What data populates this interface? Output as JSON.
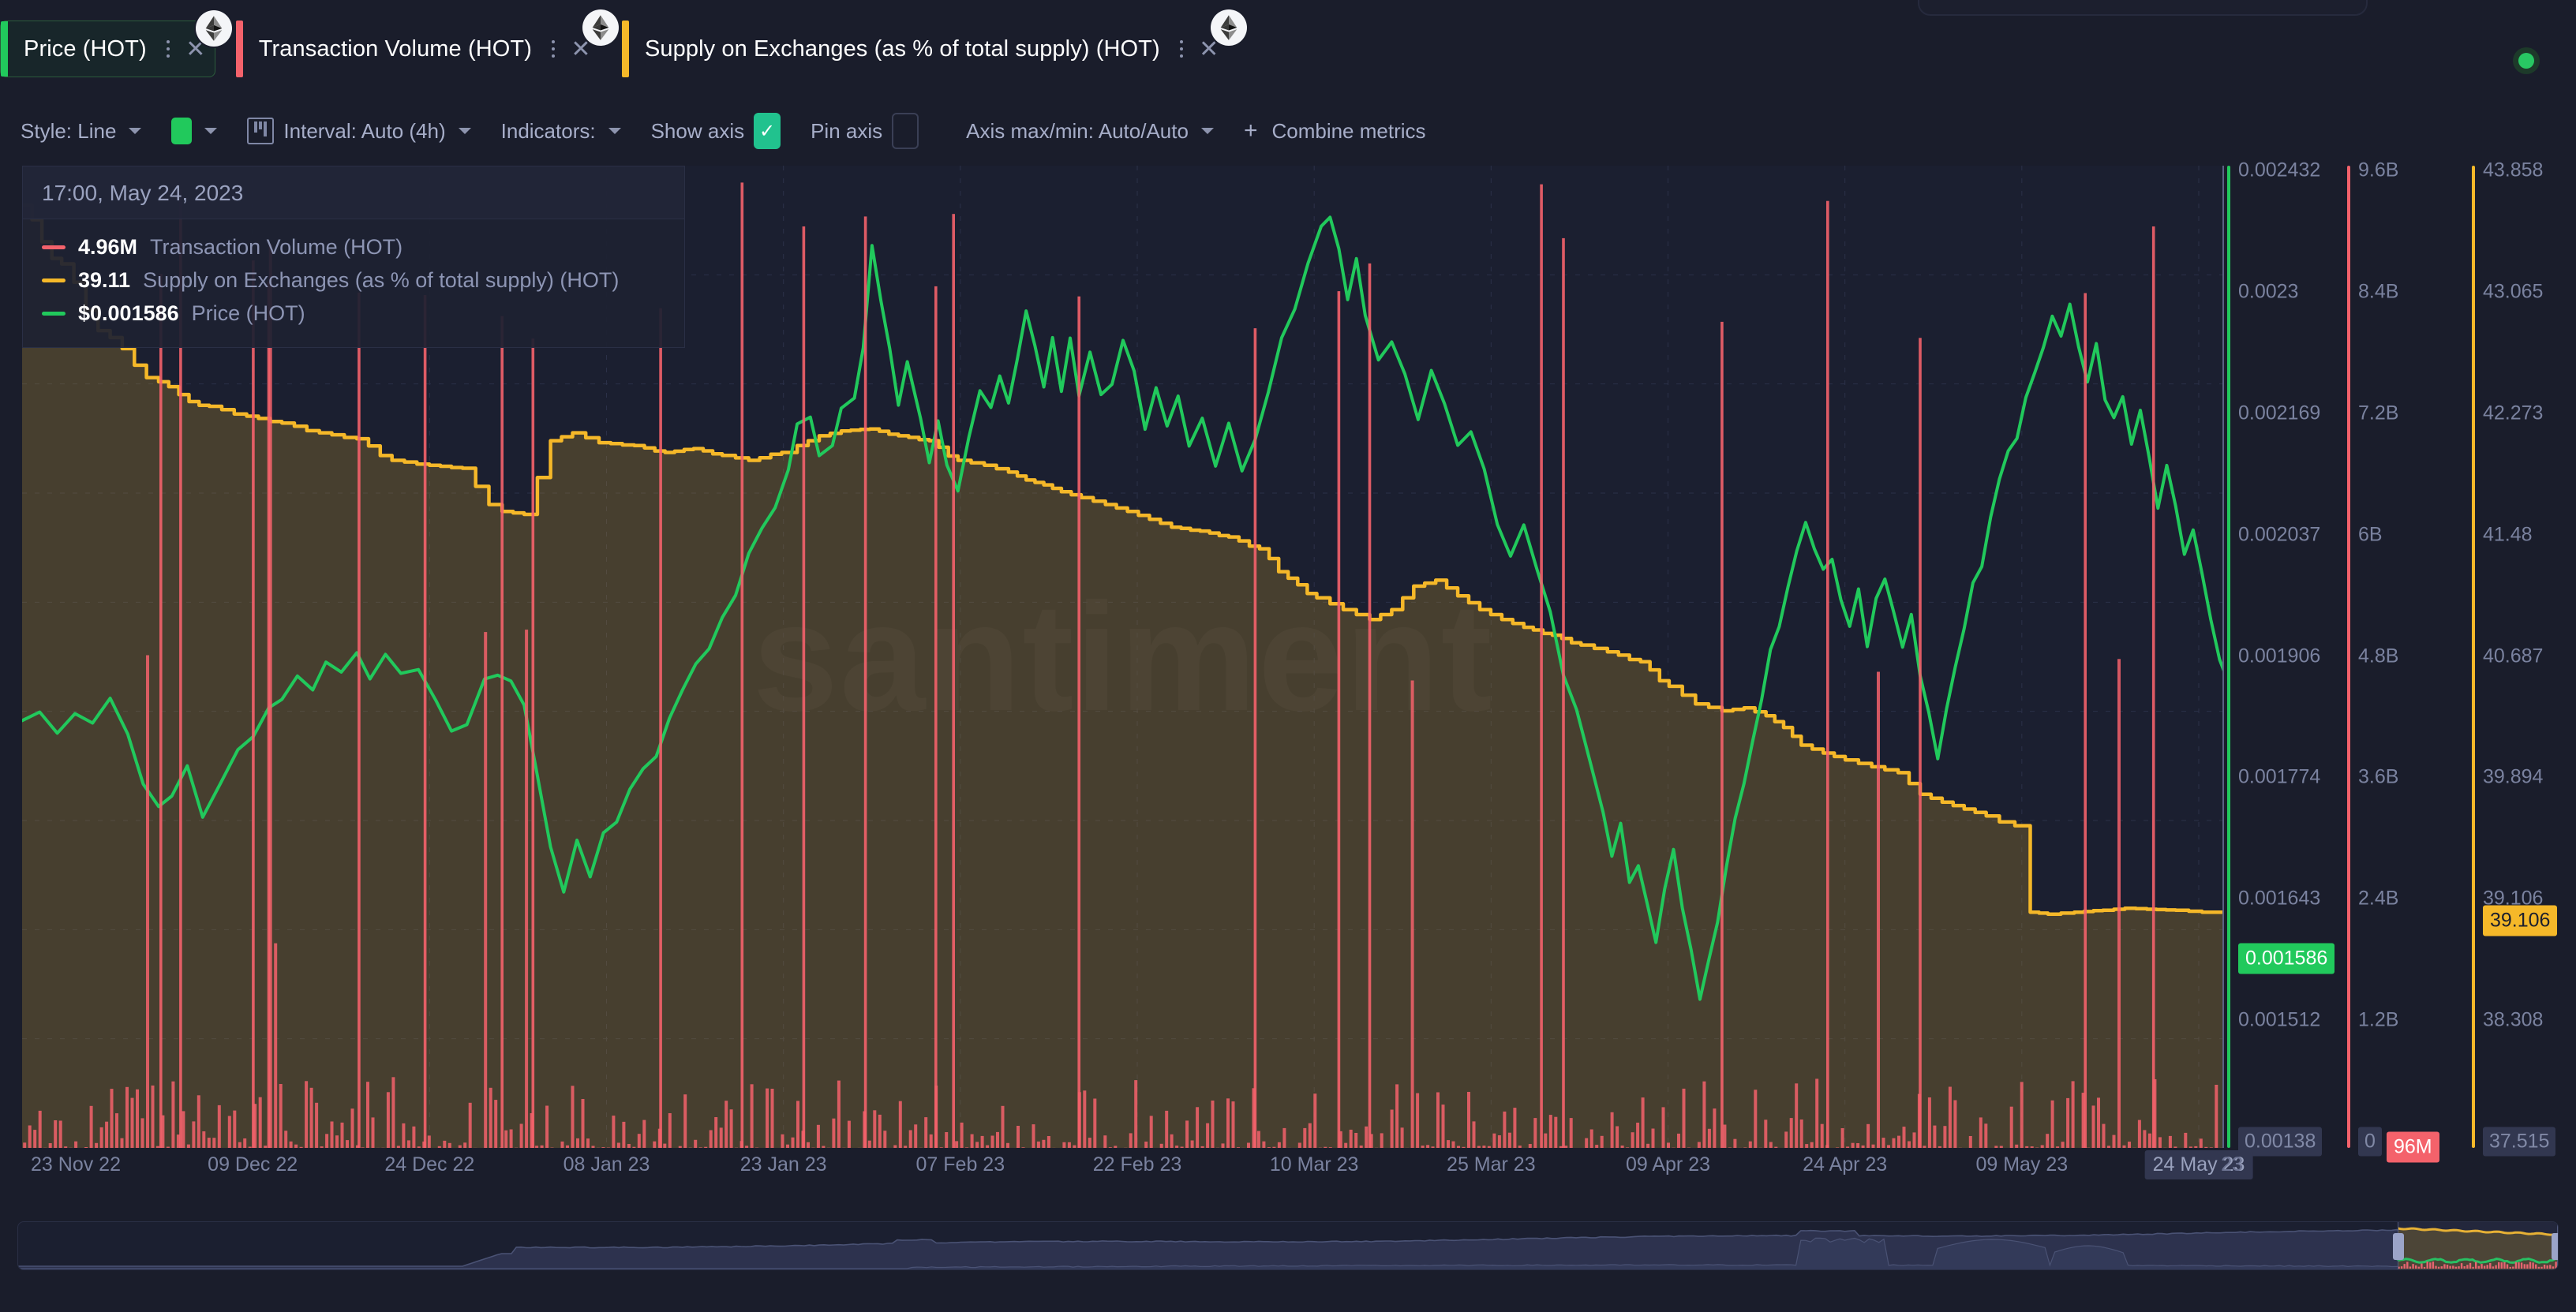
{
  "header": {
    "status_indicator": "online",
    "tabs": [
      {
        "label": "Price (HOT)",
        "accent_color": "#21c95c",
        "active": true,
        "asset_icon": "ethereum-icon",
        "menu_icon": "kebab-menu-icon",
        "close_icon": "close-icon"
      },
      {
        "label": "Transaction Volume (HOT)",
        "accent_color": "#f4626b",
        "active": false,
        "asset_icon": "ethereum-icon",
        "menu_icon": "kebab-menu-icon",
        "close_icon": "close-icon"
      },
      {
        "label": "Supply on Exchanges (as % of total supply) (HOT)",
        "accent_color": "#f5b829",
        "active": false,
        "asset_icon": "ethereum-icon",
        "menu_icon": "kebab-menu-icon",
        "close_icon": "close-icon"
      }
    ]
  },
  "toolbar": {
    "style_label": "Style: Line",
    "color_swatch": "#21c95c",
    "interval_label": "Interval: Auto (4h)",
    "indicators_label": "Indicators:",
    "show_axis_label": "Show axis",
    "show_axis_checked": true,
    "pin_axis_label": "Pin axis",
    "pin_axis_checked": false,
    "axis_minmax_label": "Axis max/min: Auto/Auto",
    "combine_metrics_label": "Combine metrics"
  },
  "tooltip": {
    "timestamp": "17:00, May 24, 2023",
    "rows": [
      {
        "value": "4.96M",
        "name": "Transaction Volume (HOT)",
        "color": "#f4626b"
      },
      {
        "value": "39.11",
        "name": "Supply on Exchanges (as % of total supply) (HOT)",
        "color": "#f5b829"
      },
      {
        "value": "$0.001586",
        "name": "Price (HOT)",
        "color": "#21c95c"
      }
    ]
  },
  "watermark": "santiment",
  "chart_data": {
    "type": "line",
    "title": "",
    "xlabel": "",
    "ylabel": "",
    "grid": true,
    "legend_position": "top-left-tooltip",
    "x_ticks": [
      "23 Nov 22",
      "09 Dec 22",
      "24 Dec 22",
      "08 Jan 23",
      "23 Jan 23",
      "07 Feb 23",
      "22 Feb 23",
      "10 Mar 23",
      "25 Mar 23",
      "09 Apr 23",
      "24 Apr 23",
      "09 May 23",
      "24 May 23",
      "23"
    ],
    "x_tick_highlighted": "24 May 23",
    "x_tick_trailing": "23",
    "axes": [
      {
        "name": "Price (HOT)",
        "color": "#21c95c",
        "ticks": [
          "0.002432",
          "0.0023",
          "0.002169",
          "0.002037",
          "0.001906",
          "0.001774",
          "0.001643",
          "0.001512",
          "0.00138"
        ],
        "range": [
          0.00138,
          0.002432
        ],
        "current_value": "0.001586",
        "current_badge_color": "#21c95c",
        "last_tick_boxed": "0.00138"
      },
      {
        "name": "Transaction Volume (HOT)",
        "color": "#f4626b",
        "ticks": [
          "9.6B",
          "8.4B",
          "7.2B",
          "6B",
          "4.8B",
          "3.6B",
          "2.4B",
          "1.2B",
          "0"
        ],
        "range": [
          0,
          9600000000
        ],
        "current_value": "96M",
        "current_badge_color": "#f4626b",
        "last_tick_boxed": "0"
      },
      {
        "name": "Supply on Exchanges (as % of total supply) (HOT)",
        "color": "#f5b829",
        "ticks": [
          "43.858",
          "43.065",
          "42.273",
          "41.48",
          "40.687",
          "39.894",
          "39.106",
          "38.308",
          "37.515"
        ],
        "range": [
          37.515,
          43.858
        ],
        "current_value": "39.106",
        "current_badge_color": "#f5b829",
        "last_tick_boxed": "37.515"
      }
    ],
    "series": [
      {
        "name": "Price (HOT)",
        "color": "#21c95c",
        "type": "line",
        "axis": 0
      },
      {
        "name": "Transaction Volume (HOT)",
        "color": "#f4626b",
        "type": "bar",
        "axis": 1
      },
      {
        "name": "Supply on Exchanges (as % of total supply) (HOT)",
        "color": "#f5b829",
        "type": "area",
        "axis": 2
      }
    ]
  },
  "navigator": {
    "selection_start_pct": 93.7,
    "selection_end_pct": 100
  }
}
